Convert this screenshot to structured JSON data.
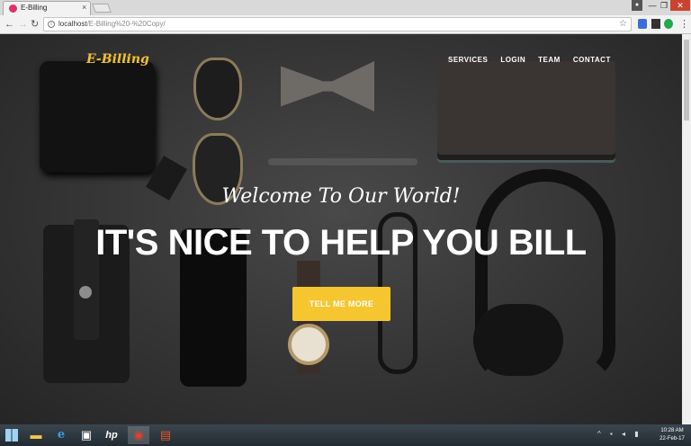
{
  "browser": {
    "tab_title": "E-Billing",
    "tab_close": "×",
    "url_host": "localhost",
    "url_path": "/E-Billing%20-%20Copy/",
    "window_controls": {
      "minimize": "—",
      "maximize": "❐",
      "close": "✕"
    }
  },
  "site": {
    "brand": "E-Billing",
    "nav": [
      "SERVICES",
      "LOGIN",
      "TEAM",
      "CONTACT"
    ],
    "hero_subtitle": "Welcome To Our World!",
    "hero_title": "IT'S NICE TO HELP YOU BILL",
    "cta_label": "TELL ME MORE"
  },
  "taskbar": {
    "apps": [
      "file-explorer",
      "internet-explorer",
      "store",
      "hp",
      "chrome",
      "app"
    ],
    "clock_time": "10:28 AM",
    "clock_date": "22-Feb-17"
  },
  "colors": {
    "accent": "#f6c631",
    "brand": "#f2c22f"
  }
}
